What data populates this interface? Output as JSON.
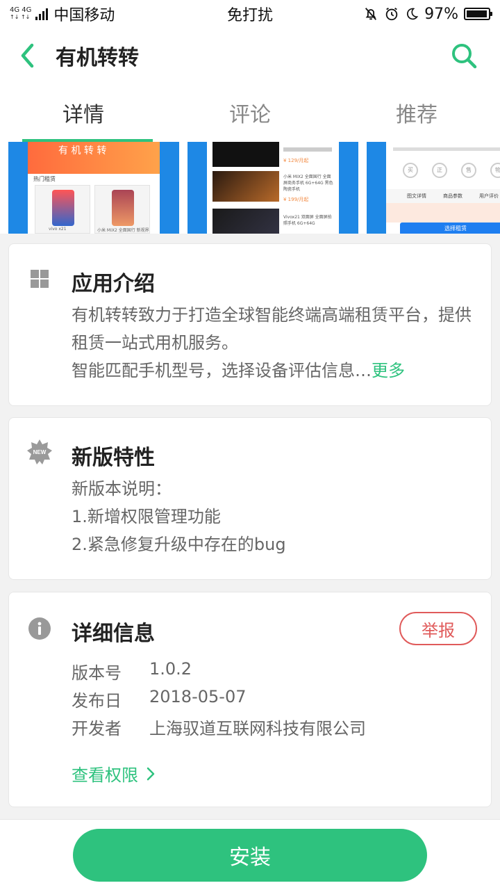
{
  "status_bar": {
    "network_type_top": "4G 4G",
    "network_type_bottom": "↑↓ ↑↓",
    "carrier": "中国移动",
    "mode": "免打扰",
    "battery_percent": "97%",
    "battery_level": 0.97
  },
  "header": {
    "title": "有机转转",
    "back_icon": "chevron-left-icon",
    "search_icon": "search-icon",
    "accent_color": "#2ec27e"
  },
  "tabs": [
    {
      "label": "详情",
      "active": true
    },
    {
      "label": "评论",
      "active": false
    },
    {
      "label": "推荐",
      "active": false
    }
  ],
  "screenshots": {
    "shot1_banner_text": "有 机 转 转",
    "shot1_section": "热门租赁",
    "shot1_items": [
      "vivo x21",
      "小米 MIX2 全面国行 新视界"
    ],
    "shot2_items": [
      "¥ 129/月起",
      "小米 MIX2 全面国行 全面屏商务手机 6G+64G 黑色 陶瓷手机",
      "¥ 199/月起",
      "Vivox21 双面屏 全面屏拍照手机 6G+64G"
    ],
    "shot3_tabs": [
      "图文详情",
      "商品参数",
      "用户评价"
    ],
    "shot3_badges": [
      "买",
      "正",
      "售",
      "物"
    ],
    "shot3_cta": "选择租赁"
  },
  "intro": {
    "title": "应用介绍",
    "icon": "grid-icon",
    "line1": "有机转转致力于打造全球智能终端高端租赁平台，提供",
    "line2": "租赁一站式用机服务。",
    "line3": "智能匹配手机型号，选择设备评估信息…",
    "more": "更多"
  },
  "whatsnew": {
    "title": "新版特性",
    "icon": "new-badge-icon",
    "icon_text": "NEW",
    "line1": "新版本说明：",
    "line2": "1.新增权限管理功能",
    "line3": "2.紧急修复升级中存在的bug"
  },
  "details": {
    "title": "详细信息",
    "icon": "info-icon",
    "report": "举报",
    "version_label": "版本号",
    "version_value": "1.0.2",
    "date_label": "发布日",
    "date_value": "2018-05-07",
    "dev_label": "开发者",
    "dev_value": "上海驭道互联网科技有限公司",
    "permissions_link": "查看权限"
  },
  "bottom": {
    "install": "安装"
  }
}
